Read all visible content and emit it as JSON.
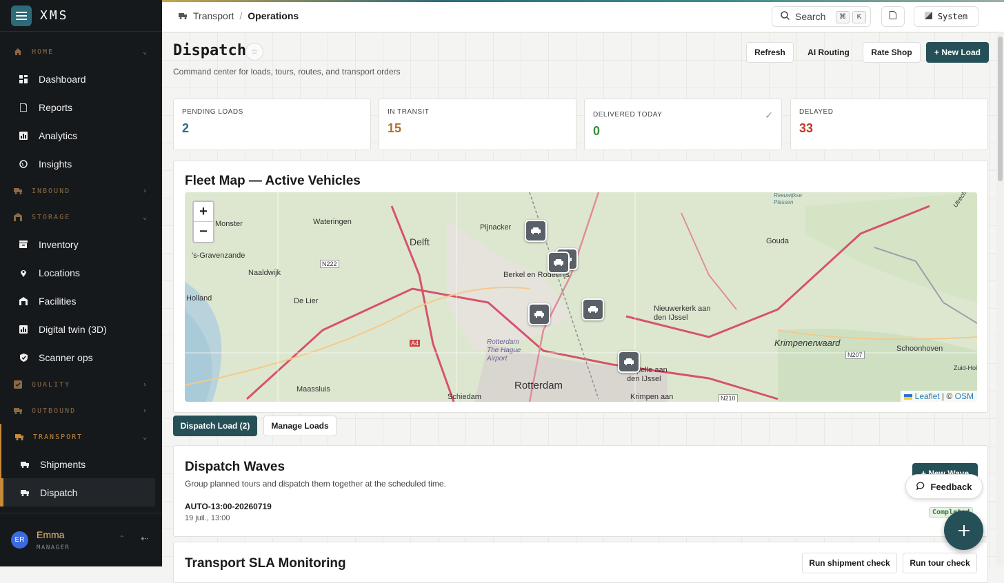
{
  "app": {
    "name": "XMS"
  },
  "sidebar": {
    "sections": [
      {
        "label": "HOME",
        "expanded": true,
        "items": [
          "Dashboard",
          "Reports",
          "Analytics",
          "Insights"
        ]
      },
      {
        "label": "INBOUND",
        "expanded": false
      },
      {
        "label": "STORAGE",
        "expanded": true,
        "items": [
          "Inventory",
          "Locations",
          "Facilities",
          "Digital twin (3D)",
          "Scanner ops"
        ]
      },
      {
        "label": "QUALITY",
        "expanded": false
      },
      {
        "label": "OUTBOUND",
        "expanded": false
      },
      {
        "label": "TRANSPORT",
        "expanded": true,
        "items": [
          "Shipments",
          "Dispatch"
        ]
      }
    ],
    "active_item": "Dispatch",
    "user": {
      "initials": "ER",
      "name": "Emma",
      "role": "MANAGER"
    }
  },
  "topbar": {
    "breadcrumb": [
      "Transport",
      "Operations"
    ],
    "search_label": "Search",
    "shortcut": [
      "⌘",
      "K"
    ],
    "theme_label": "System"
  },
  "page": {
    "title": "Dispatch",
    "subtitle": "Command center for loads, tours, routes, and transport orders",
    "actions": {
      "refresh": "Refresh",
      "ai_routing": "AI Routing",
      "rate_shop": "Rate Shop",
      "new_load": "+ New Load"
    }
  },
  "stats": [
    {
      "label": "PENDING LOADS",
      "value": "2",
      "color": "#2d6b8a"
    },
    {
      "label": "IN TRANSIT",
      "value": "15",
      "color": "#b0702a"
    },
    {
      "label": "DELIVERED TODAY",
      "value": "0",
      "color": "#3c8a3c"
    },
    {
      "label": "DELAYED",
      "value": "33",
      "color": "#c0392b"
    }
  ],
  "fleet_map": {
    "title": "Fleet Map — Active Vehicles",
    "zoom_in": "+",
    "zoom_out": "−",
    "place_labels": [
      "Monster",
      "Wateringen",
      "Delft",
      "Pijnacker",
      "Gouda",
      "'s-Gravenzande",
      "Naaldwijk",
      "N222",
      "Berkel en Rodenrijs",
      "De Lier",
      "Nieuwerkerk aan den IJssel",
      "Krimpenerwaard",
      "Schoonhoven",
      "N207",
      "Rotterdam The Hague Airport",
      "Rotterdam",
      "Capelle aan den IJssel",
      "Maassluis",
      "Schiedam",
      "Krimpen aan",
      "A4",
      "Reeuwijkse Plassen",
      "Zuid-Hol",
      "N210",
      "Utrecht",
      "Holland"
    ],
    "attribution": {
      "leaflet": "Leaflet",
      "sep": "| ©",
      "osm": "OSM"
    },
    "vehicle_count": 6
  },
  "tabs": {
    "dispatch_load": "Dispatch Load (2)",
    "manage_loads": "Manage Loads"
  },
  "dispatch_waves": {
    "title": "Dispatch Waves",
    "description": "Group planned tours and dispatch them together at the scheduled time.",
    "new_wave_label": "+ New Wave",
    "wave": {
      "id": "AUTO-13:00-20260719",
      "time": "19 juil., 13:00",
      "status": "Completed"
    }
  },
  "sla": {
    "title": "Transport SLA Monitoring",
    "run_shipment": "Run shipment check",
    "run_tour": "Run tour check"
  },
  "feedback_label": "Feedback",
  "colors": {
    "accent": "#255058",
    "sidebar_bg": "#16191c",
    "section": "#8a6a44"
  }
}
